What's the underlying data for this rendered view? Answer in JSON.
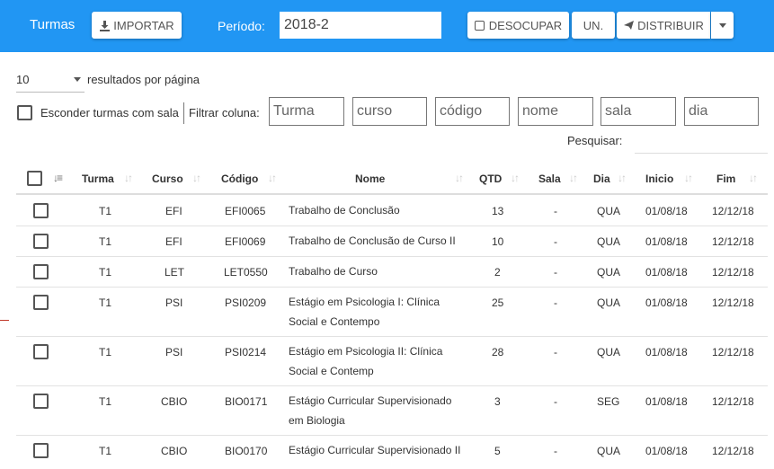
{
  "toolbar": {
    "title": "Turmas",
    "import_label": "IMPORTAR",
    "periodo_label": "Período:",
    "periodo_value": "2018-2",
    "desocupar_label": "DESOCUPAR",
    "un_label": "UN.",
    "distribuir_label": "DISTRIBUIR"
  },
  "controls": {
    "page_length": "10",
    "page_length_suffix": "resultados por página",
    "hide_label": "Esconder turmas com sala",
    "filter_label": "Filtrar coluna:",
    "filters": [
      "Turma",
      "curso",
      "código",
      "nome",
      "sala",
      "dia"
    ],
    "search_label": "Pesquisar:",
    "search_value": ""
  },
  "table": {
    "headers": [
      "Turma",
      "Curso",
      "Código",
      "Nome",
      "QTD",
      "Sala",
      "Dia",
      "Inicio",
      "Fim"
    ],
    "rows": [
      {
        "turma": "T1",
        "curso": "EFI",
        "codigo": "EFI0065",
        "nome": "Trabalho de Conclusão",
        "qtd": "13",
        "sala": "-",
        "dia": "QUA",
        "inicio": "01/08/18",
        "fim": "12/12/18"
      },
      {
        "turma": "T1",
        "curso": "EFI",
        "codigo": "EFI0069",
        "nome": "Trabalho de Conclusão de Curso II",
        "qtd": "10",
        "sala": "-",
        "dia": "QUA",
        "inicio": "01/08/18",
        "fim": "12/12/18"
      },
      {
        "turma": "T1",
        "curso": "LET",
        "codigo": "LET0550",
        "nome": "Trabalho de Curso",
        "qtd": "2",
        "sala": "-",
        "dia": "QUA",
        "inicio": "01/08/18",
        "fim": "12/12/18"
      },
      {
        "turma": "T1",
        "curso": "PSI",
        "codigo": "PSI0209",
        "nome": "Estágio em Psicologia I: Clínica Social e Contempo",
        "qtd": "25",
        "sala": "-",
        "dia": "QUA",
        "inicio": "01/08/18",
        "fim": "12/12/18"
      },
      {
        "turma": "T1",
        "curso": "PSI",
        "codigo": "PSI0214",
        "nome": "Estágio em Psicologia II: Clínica Social e Contemp",
        "qtd": "28",
        "sala": "-",
        "dia": "QUA",
        "inicio": "01/08/18",
        "fim": "12/12/18"
      },
      {
        "turma": "T1",
        "curso": "CBIO",
        "codigo": "BIO0171",
        "nome": "Estágio Curricular Supervisionado em Biologia",
        "qtd": "3",
        "sala": "-",
        "dia": "SEG",
        "inicio": "01/08/18",
        "fim": "12/12/18"
      },
      {
        "turma": "T1",
        "curso": "CBIO",
        "codigo": "BIO0170",
        "nome": "Estágio Curricular Supervisionado II",
        "qtd": "5",
        "sala": "-",
        "dia": "QUA",
        "inicio": "01/08/18",
        "fim": "12/12/18"
      }
    ]
  }
}
